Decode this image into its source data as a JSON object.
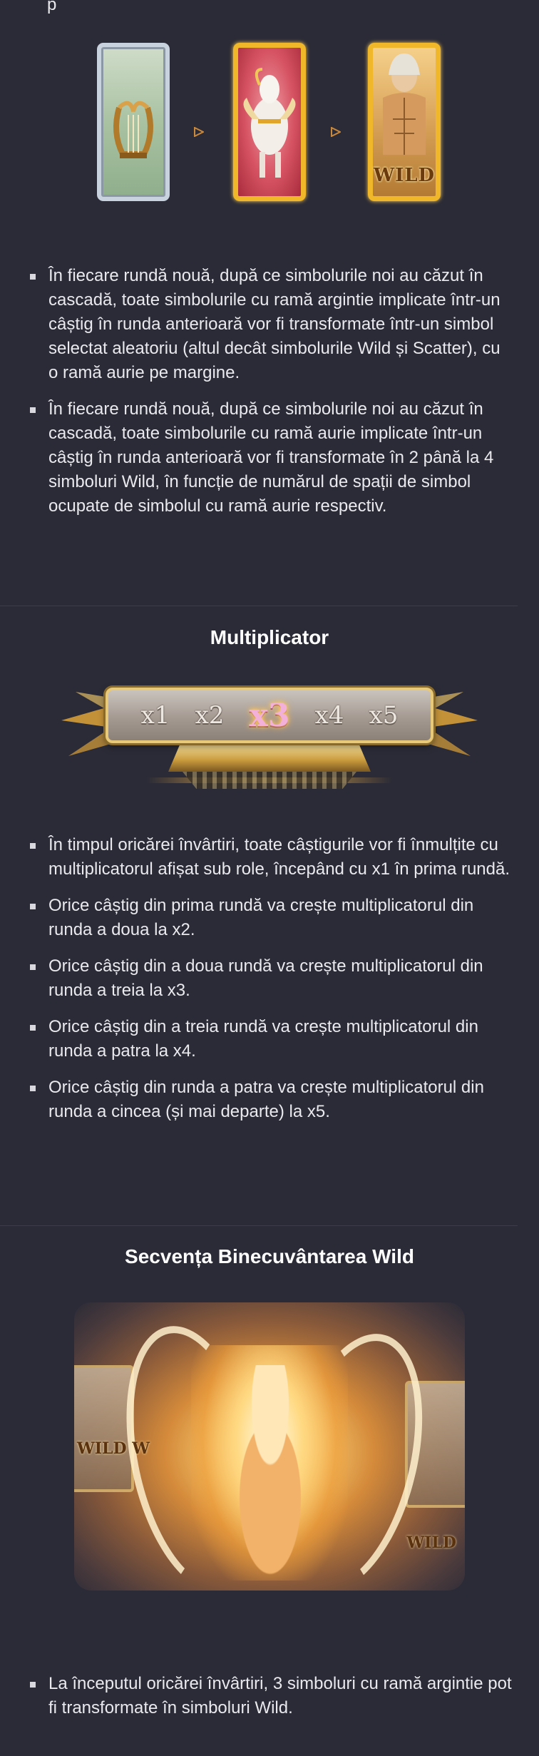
{
  "top_partial_text": "p",
  "symbols": {
    "tiles": [
      "lyre-symbol",
      "winged-horse-symbol",
      "zeus-wild-symbol"
    ],
    "wild_label": "WILD"
  },
  "list1": [
    "În fiecare rundă nouă, după ce simbolurile noi au căzut în cascadă, toate simbolurile cu ramă argintie implicate într-un câștig în runda anterioară vor fi transformate într-un simbol selectat aleatoriu (altul decât simbolurile Wild și Scatter), cu o ramă aurie pe margine.",
    "În fiecare rundă nouă, după ce simbolurile noi au căzut în cascadă, toate simbolurile cu ramă aurie implicate într-un câștig în runda anterioară vor fi transformate în 2 până la 4 simboluri Wild, în funcție de numărul de spații de simbol ocupate de simbolul cu ramă aurie respectiv."
  ],
  "multiplier": {
    "title": "Multiplicator",
    "items": [
      "x1",
      "x2",
      "x3",
      "x4",
      "x5"
    ],
    "active": "x3"
  },
  "list2": [
    "În timpul oricărei învârtiri, toate câștigurile vor fi înmulțite cu multiplicatorul afișat sub role, începând cu x1 în prima rundă.",
    "Orice câștig din prima rundă va crește multiplicatorul din runda a doua la x2.",
    "Orice câștig din a doua rundă va crește multiplicatorul din runda a treia la x3.",
    "Orice câștig din a treia rundă va crește multiplicatorul din runda a patra la x4.",
    "Orice câștig din runda a patra va crește multiplicatorul din runda a cincea (și mai departe) la x5."
  ],
  "blessing": {
    "title": "Secvența Binecuvântarea Wild",
    "wild_labels": [
      "WILD W",
      "WILD"
    ]
  },
  "list3": [
    "La începutul oricărei învârtiri, 3 simboluri cu ramă argintie pot fi transformate în simboluri Wild."
  ],
  "colors": {
    "background": "#2b2b37",
    "text": "#e9e9ee",
    "gold": "#f0b72a",
    "silver": "#c8d2de"
  }
}
